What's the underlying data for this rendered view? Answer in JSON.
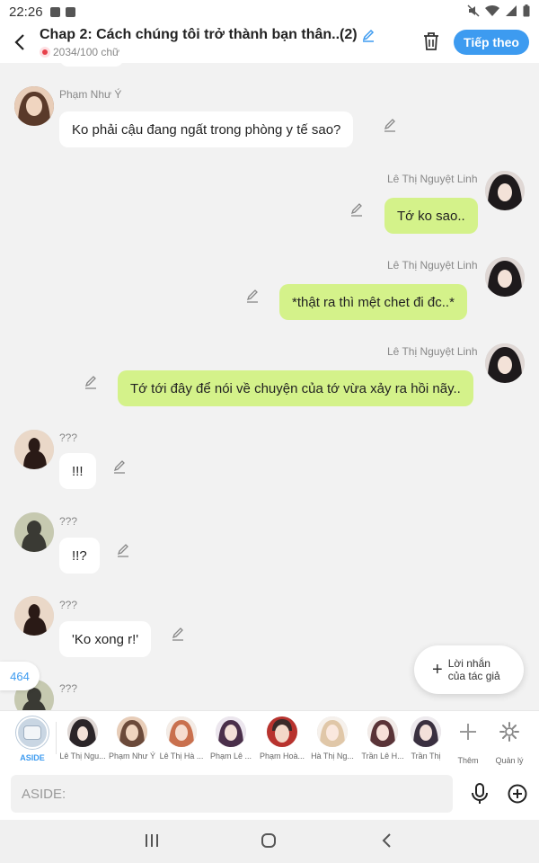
{
  "status_bar": {
    "time": "22:26"
  },
  "header": {
    "title": "Chap 2: Cách chúng tôi trở thành bạn thân..(2)",
    "word_count": "2034/100 chữ",
    "next_button": "Tiếp theo",
    "accent": "#3d9bf0"
  },
  "messages": [
    {
      "name": "Phạm Như Ý",
      "text": "Ko phải cậu đang ngất trong phòng y tế sao?",
      "side": "left"
    },
    {
      "name": "Lê Thị Nguyệt Linh",
      "text": "Tớ ko sao..",
      "side": "right"
    },
    {
      "name": "Lê Thị Nguyệt Linh",
      "text": "*thật ra thì mệt chet đi đc..*",
      "side": "right"
    },
    {
      "name": "Lê Thị Nguyệt Linh",
      "text": "Tớ tới đây để nói về chuyện của tớ vừa xảy ra hồi nãy..",
      "side": "right"
    },
    {
      "name": "???",
      "text": "!!!",
      "side": "left"
    },
    {
      "name": "???",
      "text": "!!?",
      "side": "left"
    },
    {
      "name": "???",
      "text": "'Ko xong r!'",
      "side": "left"
    },
    {
      "name": "???",
      "text": "",
      "side": "left"
    }
  ],
  "count_badge": "464",
  "author_note": {
    "line1": "Lời nhắn",
    "line2": "của tác giả"
  },
  "characters": [
    {
      "label": "ASIDE",
      "icon": "aside-icon"
    },
    {
      "label": "Lê Thị Ngu...",
      "color": "#2b2528"
    },
    {
      "label": "Phạm Như Ý",
      "color": "#6b4a3a"
    },
    {
      "label": "Lê Thị Hà ...",
      "color": "#c9704e"
    },
    {
      "label": "Phạm Lê ...",
      "color": "#4a2f4a"
    },
    {
      "label": "Phạm Hoà...",
      "color": "#3a2a28"
    },
    {
      "label": "Hà Thị Ng...",
      "color": "#e0c7a8"
    },
    {
      "label": "Trần Lê H...",
      "color": "#5a3438"
    },
    {
      "label": "Trần Thị",
      "color": "#3a3040"
    }
  ],
  "more_label": "Thêm",
  "manage_label": "Quản lý",
  "input_placeholder": "ASIDE:"
}
